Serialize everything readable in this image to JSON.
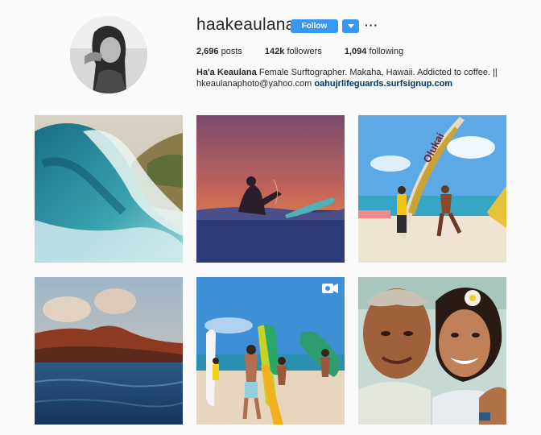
{
  "profile": {
    "username": "haakeaulana",
    "follow_label": "Follow",
    "dropdown_icon": "caret-down-icon",
    "more_label": "···",
    "stats": {
      "posts_count": "2,696",
      "posts_label": "posts",
      "followers_count": "142k",
      "followers_label": "followers",
      "following_count": "1,094",
      "following_label": "following"
    },
    "bio": {
      "name": "Ha'a Keaulana",
      "text": "Female Surftographer. Makaha, Hawaii. Addicted to coffee. ||",
      "email": "hkeaulanaphoto@yahoo.com",
      "link": "oahujrlifeguards.surfsignup.com"
    }
  },
  "posts": [
    {
      "name": "post-wave-barrel"
    },
    {
      "name": "post-sunset-surfer"
    },
    {
      "name": "post-beach-banners",
      "banner_text": "Olukai"
    },
    {
      "name": "post-diamond-head"
    },
    {
      "name": "post-surfboards-beach",
      "badge_icon": "video-icon"
    },
    {
      "name": "post-couple-portrait"
    }
  ],
  "colors": {
    "accent": "#3897f0",
    "link": "#003569",
    "background": "#fafafa"
  }
}
